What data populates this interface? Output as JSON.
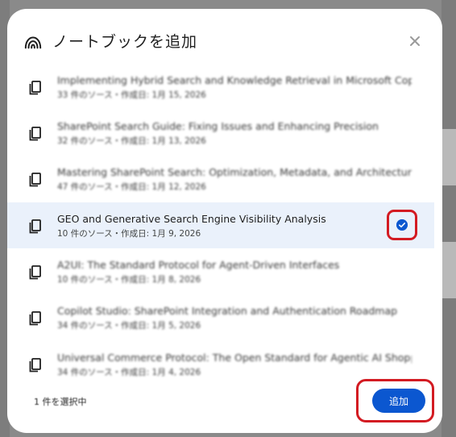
{
  "dialog": {
    "title": "ノートブックを追加",
    "header_icon": "notebooklm-logo-icon",
    "close_icon": "close-icon"
  },
  "notebooks": [
    {
      "title": "Implementing Hybrid Search and Knowledge Retrieval in Microsoft Copilot",
      "meta": "33 件のソース・作成日: 1月 15, 2026",
      "selected": false
    },
    {
      "title": "SharePoint Search Guide: Fixing Issues and Enhancing Precision",
      "meta": "32 件のソース・作成日: 1月 13, 2026",
      "selected": false
    },
    {
      "title": "Mastering SharePoint Search: Optimization, Metadata, and Architecture",
      "meta": "47 件のソース・作成日: 1月 12, 2026",
      "selected": false
    },
    {
      "title": "GEO and Generative Search Engine Visibility Analysis",
      "meta": "10 件のソース・作成日: 1月 9, 2026",
      "selected": true
    },
    {
      "title": "A2UI: The Standard Protocol for Agent-Driven Interfaces",
      "meta": "10 件のソース・作成日: 1月 8, 2026",
      "selected": false
    },
    {
      "title": "Copilot Studio: SharePoint Integration and Authentication Roadmap",
      "meta": "34 件のソース・作成日: 1月 5, 2026",
      "selected": false
    },
    {
      "title": "Universal Commerce Protocol: The Open Standard for Agentic AI Shopping",
      "meta": "34 件のソース・作成日: 1月 4, 2026",
      "selected": false
    }
  ],
  "footer": {
    "selection_count": "1 件を選択中",
    "add_label": "追加"
  },
  "colors": {
    "accent": "#0b57d0",
    "selected_bg": "#eaf1fb",
    "highlight": "#d31b22"
  }
}
